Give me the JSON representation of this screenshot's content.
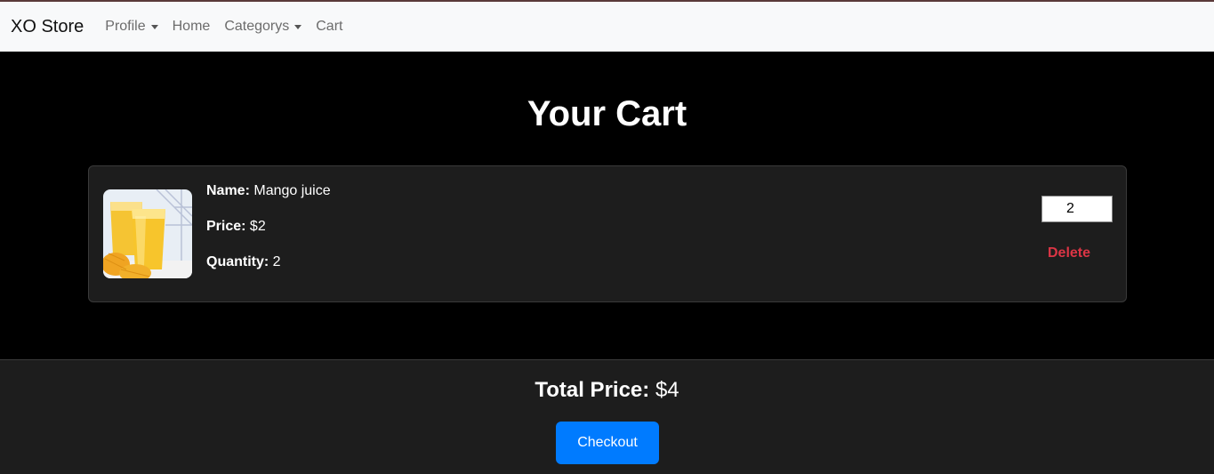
{
  "navbar": {
    "brand": "XO Store",
    "items": [
      {
        "label": "Profile",
        "dropdown": true
      },
      {
        "label": "Home",
        "dropdown": false
      },
      {
        "label": "Categorys",
        "dropdown": true
      },
      {
        "label": "Cart",
        "dropdown": false
      }
    ]
  },
  "page": {
    "title": "Your Cart"
  },
  "cart": {
    "items": [
      {
        "image_icon": "mango-juice-image",
        "name_label": "Name:",
        "name": "Mango juice",
        "price_label": "Price:",
        "price": "$2",
        "quantity_label": "Quantity:",
        "quantity": "2",
        "quantity_input_value": "2",
        "delete_label": "Delete"
      }
    ]
  },
  "summary": {
    "total_label": "Total Price:",
    "total_value": "$4",
    "checkout_label": "Checkout"
  },
  "colors": {
    "accent": "#007bff",
    "danger": "#dc3545",
    "navbar_bg": "#f8f9fa",
    "card_bg": "#1d1d1d"
  }
}
